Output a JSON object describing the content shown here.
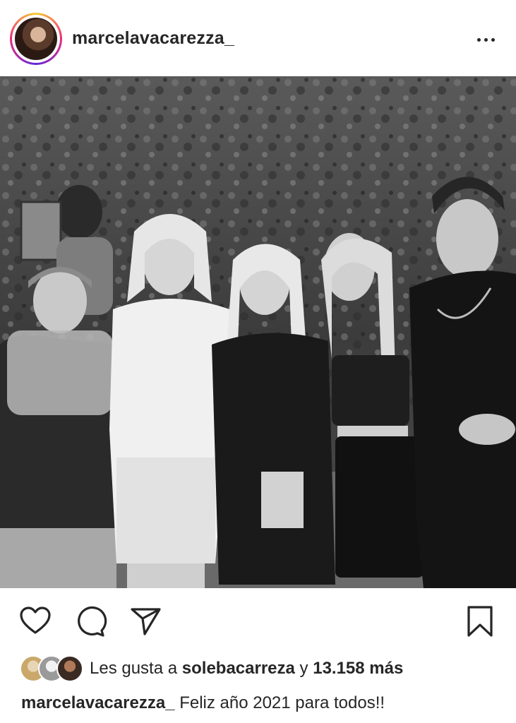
{
  "post": {
    "username": "marcelavacarezza_",
    "more_icon": "more-horizontal-icon"
  },
  "actions": {
    "like_icon": "heart-icon",
    "comment_icon": "comment-icon",
    "share_icon": "send-icon",
    "save_icon": "bookmark-icon"
  },
  "likes": {
    "prefix": "Les gusta a",
    "liker": "solebacarreza",
    "conjunction": "y",
    "count": "13.158 más"
  },
  "caption": {
    "username": "marcelavacarezza_",
    "text": "Feliz año 2021 para todos!!"
  }
}
